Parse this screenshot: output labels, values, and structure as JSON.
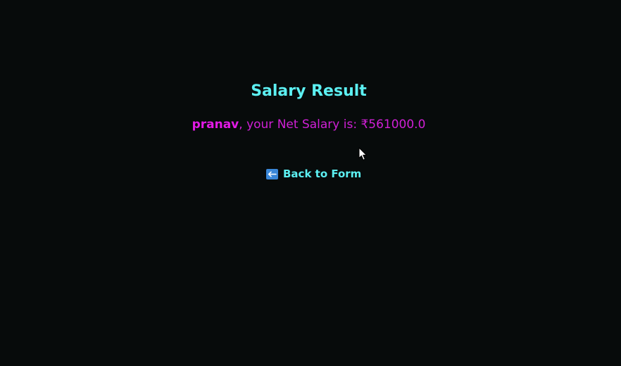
{
  "page": {
    "title": "Salary Result"
  },
  "result": {
    "name": "pranav",
    "message": ", your Net Salary is: ",
    "amount": "₹561000.0"
  },
  "back_link": {
    "icon": "left-arrow-icon",
    "label": "Back to Form"
  },
  "colors": {
    "background": "#070b0b",
    "title": "#5cf0f2",
    "result_text": "#d020d6",
    "icon_bg": "#3a87d8"
  }
}
